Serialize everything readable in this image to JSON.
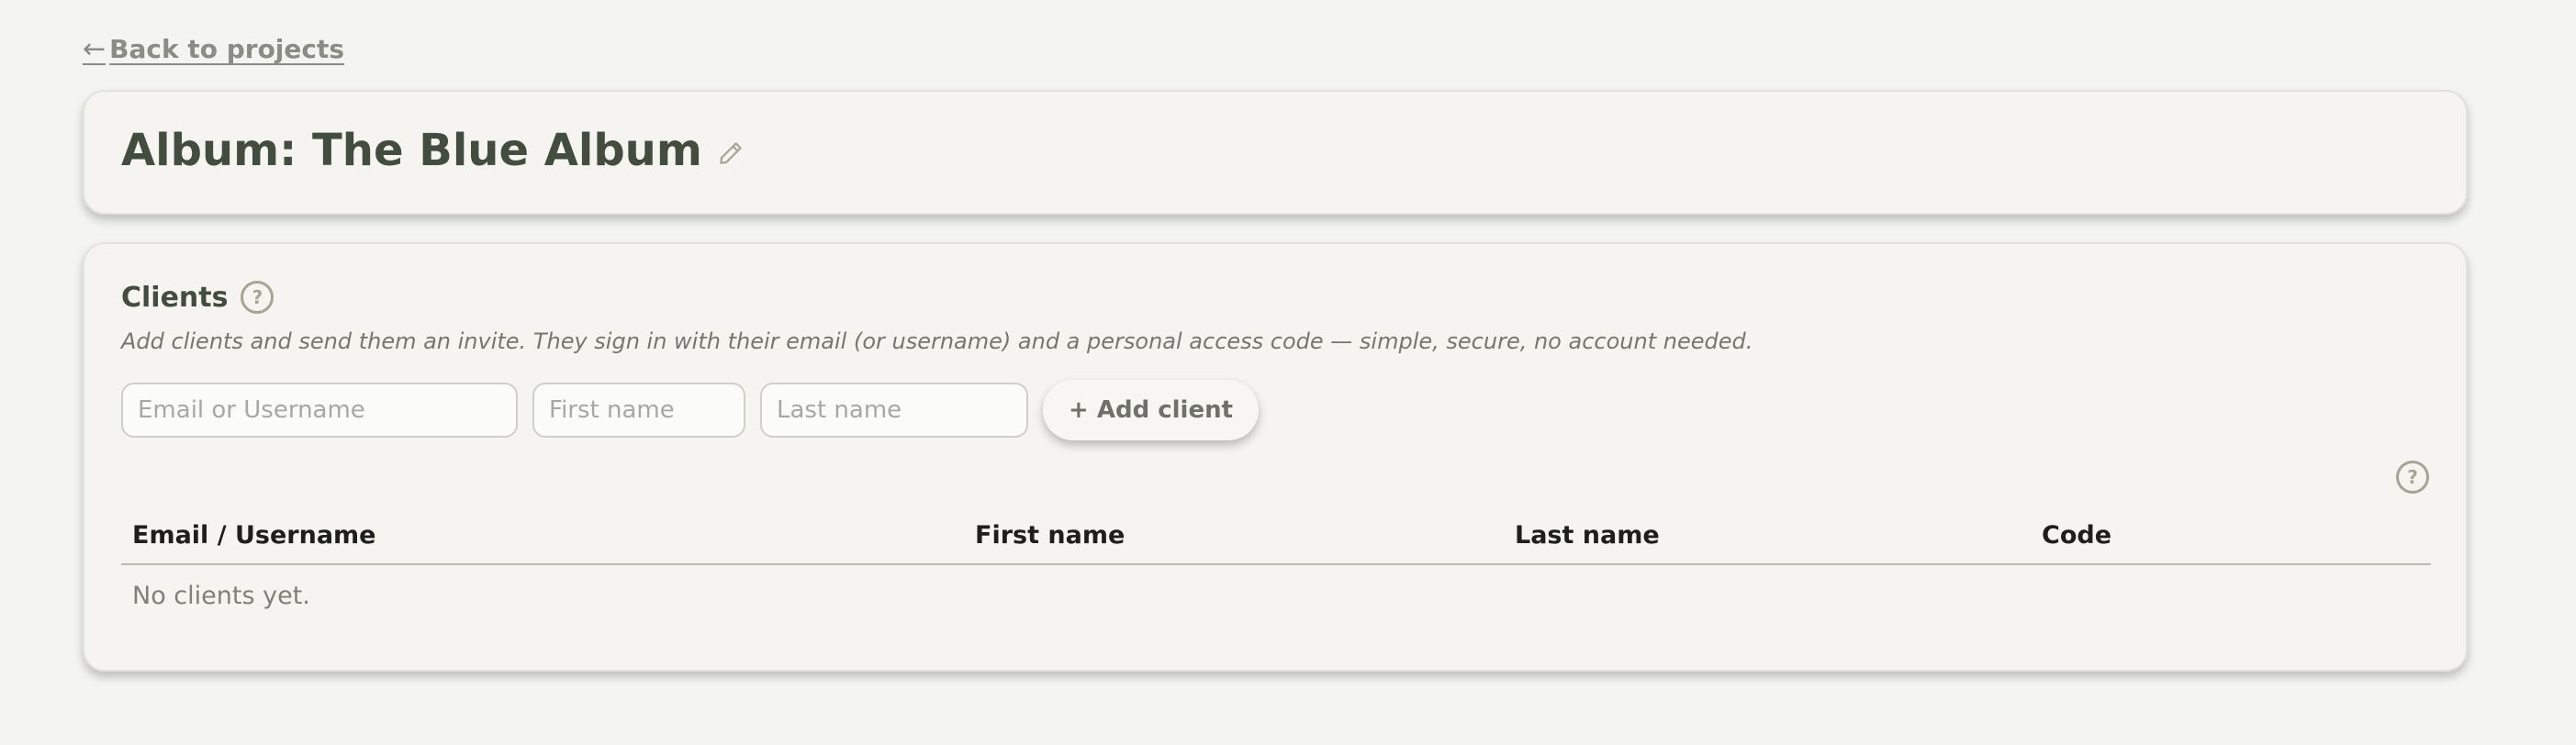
{
  "nav": {
    "back_arrow": "←",
    "back_label": "Back to projects"
  },
  "header": {
    "title": "Album: The Blue Album",
    "edit_icon": "pencil-icon"
  },
  "clients": {
    "title": "Clients",
    "help_glyph": "?",
    "description": "Add clients and send them an invite. They sign in with their email (or username) and a personal access code — simple, secure, no account needed.",
    "form": {
      "email_value": "",
      "email_placeholder": "Email or Username",
      "first_value": "",
      "first_placeholder": "First name",
      "last_value": "",
      "last_placeholder": "Last name",
      "add_label": "+ Add client"
    },
    "table": {
      "help_glyph": "?",
      "columns": [
        "Email / Username",
        "First name",
        "Last name",
        "Code"
      ],
      "rows": [],
      "empty_text": "No clients yet."
    }
  },
  "colors": {
    "background": "#f4f4f3",
    "card": "#f5f4f0",
    "title_text": "#434d3f",
    "muted_text": "#8b8c83",
    "icon": "#a4a595"
  }
}
